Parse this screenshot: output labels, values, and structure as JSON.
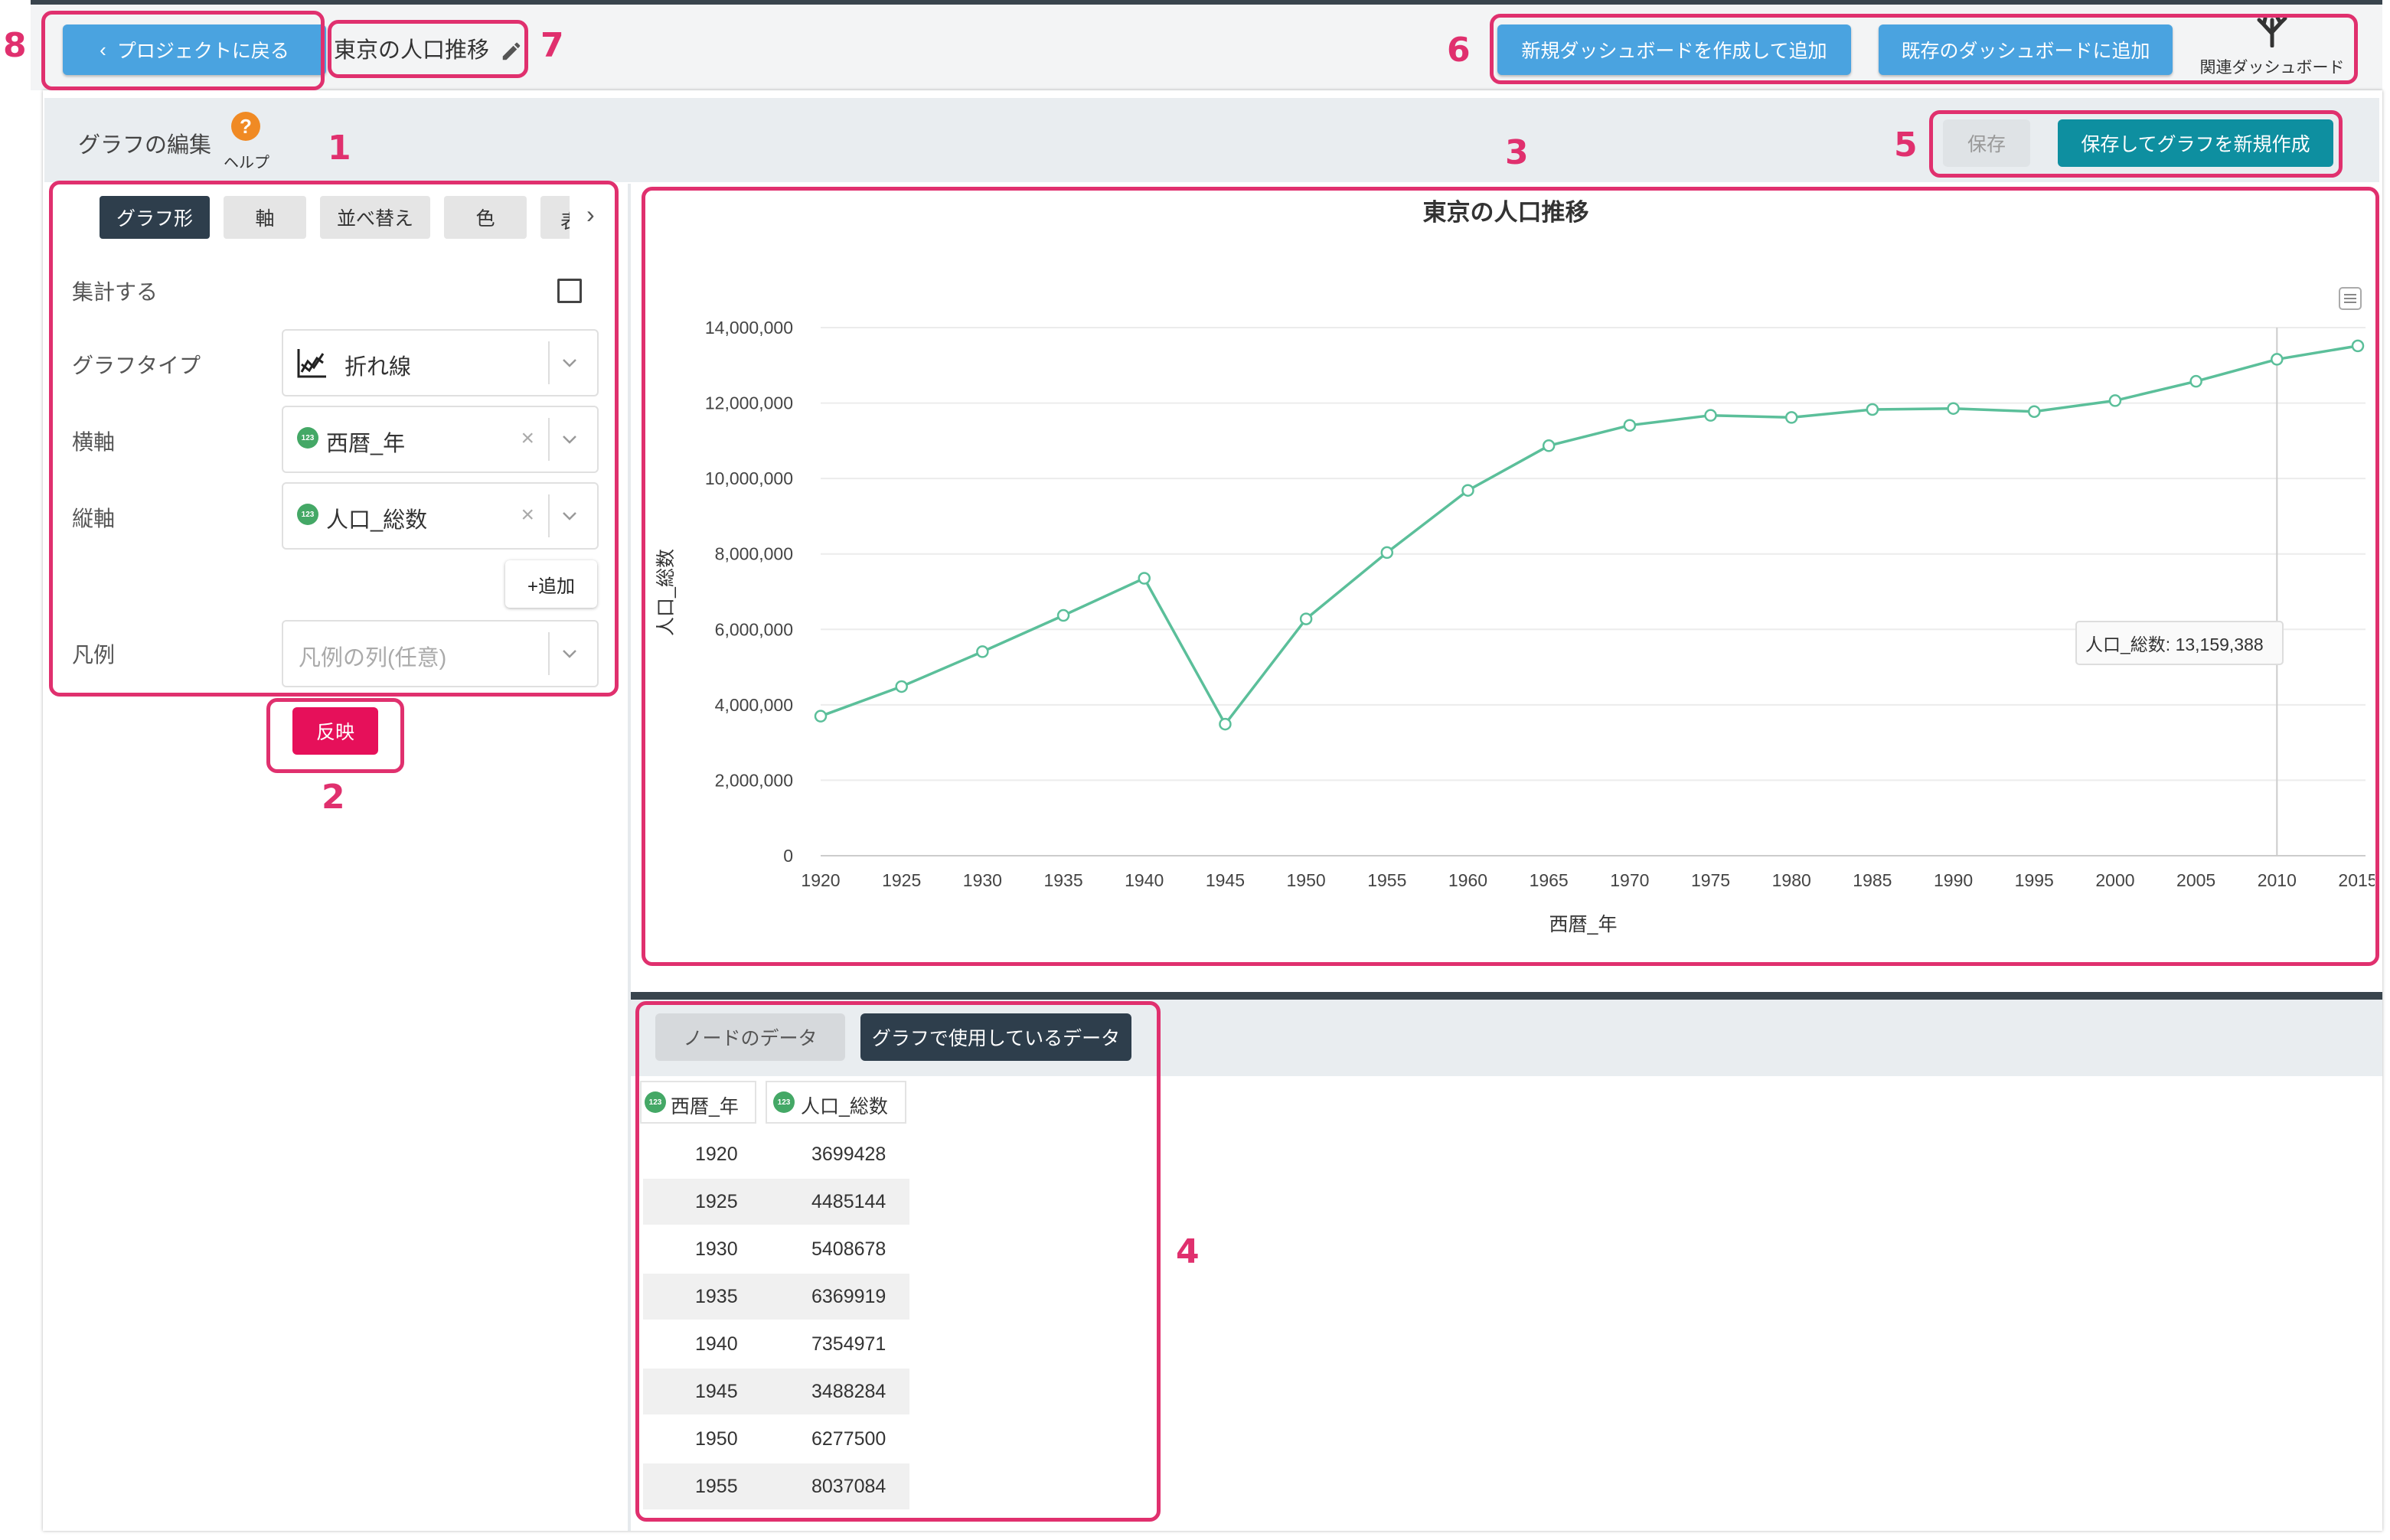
{
  "header": {
    "back_button": "プロジェクトに戻る",
    "page_title": "東京の人口推移",
    "new_dashboard_button": "新規ダッシュボードを作成して追加",
    "existing_dashboard_button": "既存のダッシュボードに追加",
    "related_dashboard_label": "関連ダッシュボード"
  },
  "editor": {
    "title": "グラフの編集",
    "help_label": "ヘルプ",
    "save_button": "保存",
    "save_new_button": "保存してグラフを新規作成"
  },
  "tabs": [
    {
      "label": "グラフ形",
      "active": true
    },
    {
      "label": "軸",
      "active": false
    },
    {
      "label": "並べ替え",
      "active": false
    },
    {
      "label": "色",
      "active": false
    },
    {
      "label": "表",
      "active": false
    }
  ],
  "form": {
    "aggregate_label": "集計する",
    "graph_type_label": "グラフタイプ",
    "graph_type_value": "折れ線",
    "x_axis_label": "横軸",
    "x_axis_value": "西暦_年",
    "y_axis_label": "縦軸",
    "y_axis_value": "人口_総数",
    "add_button": "+追加",
    "legend_label": "凡例",
    "legend_placeholder": "凡例の列(任意)",
    "apply_button": "反映",
    "type_badge": "123"
  },
  "data_panel": {
    "tab_node": "ノードのデータ",
    "tab_graph": "グラフで使用しているデータ",
    "col_year": "西暦_年",
    "col_pop": "人口_総数",
    "rows": [
      [
        "1920",
        "3699428"
      ],
      [
        "1925",
        "4485144"
      ],
      [
        "1930",
        "5408678"
      ],
      [
        "1935",
        "6369919"
      ],
      [
        "1940",
        "7354971"
      ],
      [
        "1945",
        "3488284"
      ],
      [
        "1950",
        "6277500"
      ],
      [
        "1955",
        "8037084"
      ]
    ]
  },
  "callouts": [
    "1",
    "2",
    "3",
    "4",
    "5",
    "6",
    "7",
    "8"
  ],
  "colors": {
    "accent": "#e0306e",
    "primary": "#4aa3e0",
    "teal": "#0e8fa0",
    "line": "#5bbf9a",
    "dark": "#2e3e4c"
  },
  "chart_data": {
    "type": "line",
    "title": "東京の人口推移",
    "xlabel": "西暦_年",
    "ylabel": "人口_総数",
    "ylim": [
      0,
      14000000
    ],
    "yticks": [
      "0",
      "2,000,000",
      "4,000,000",
      "6,000,000",
      "8,000,000",
      "10,000,000",
      "12,000,000",
      "14,000,000"
    ],
    "x": [
      1920,
      1925,
      1930,
      1935,
      1940,
      1945,
      1950,
      1955,
      1960,
      1965,
      1970,
      1975,
      1980,
      1985,
      1990,
      1995,
      2000,
      2005,
      2010,
      2015
    ],
    "series": [
      {
        "name": "人口_総数",
        "values": [
          3699428,
          4485144,
          5408678,
          6369919,
          7354971,
          3488284,
          6277500,
          8037084,
          9683802,
          10869244,
          11408071,
          11673554,
          11618281,
          11829363,
          11855563,
          11773605,
          12064101,
          12576601,
          13159388,
          13515271
        ]
      }
    ],
    "tooltip": "人口_総数: 13,159,388",
    "tooltip_x": 2010,
    "grid": true
  }
}
